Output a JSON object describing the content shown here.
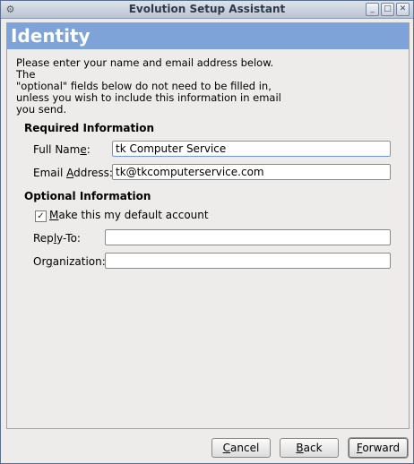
{
  "window": {
    "title": "Evolution Setup Assistant",
    "app_icon": "gear-icon",
    "controls": [
      "minimize-icon",
      "maximize-icon",
      "close-icon"
    ]
  },
  "page": {
    "title": "Identity",
    "intro": "Please enter your name and email address below. The\n\"optional\" fields below do not need to be filled in,\nunless you wish to include this information in email\nyou send."
  },
  "required": {
    "section_title": "Required Information",
    "full_name": {
      "label_pre": "Full Nam",
      "label_mnemonic": "e",
      "label_post": ":",
      "value": "tk Computer Service"
    },
    "email": {
      "label_pre": "Email ",
      "label_mnemonic": "A",
      "label_post": "ddress:",
      "value": "tk@tkcomputerservice.com"
    }
  },
  "optional": {
    "section_title": "Optional Information",
    "default_account": {
      "label_pre": "",
      "label_mnemonic": "M",
      "label_post": "ake this my default account",
      "checked": true
    },
    "reply_to": {
      "label_pre": "Rep",
      "label_mnemonic": "l",
      "label_post": "y-To:",
      "value": ""
    },
    "organization": {
      "label_pre": "Or",
      "label_mnemonic": "g",
      "label_post": "anization:",
      "value": ""
    }
  },
  "buttons": {
    "cancel": {
      "label_pre": "",
      "label_mnemonic": "C",
      "label_post": "ancel"
    },
    "back": {
      "label_pre": "",
      "label_mnemonic": "B",
      "label_post": "ack"
    },
    "forward": {
      "label_pre": "",
      "label_mnemonic": "F",
      "label_post": "orward"
    }
  },
  "colors": {
    "header_band": "#7da3d8",
    "window_bg": "#edeceb"
  }
}
